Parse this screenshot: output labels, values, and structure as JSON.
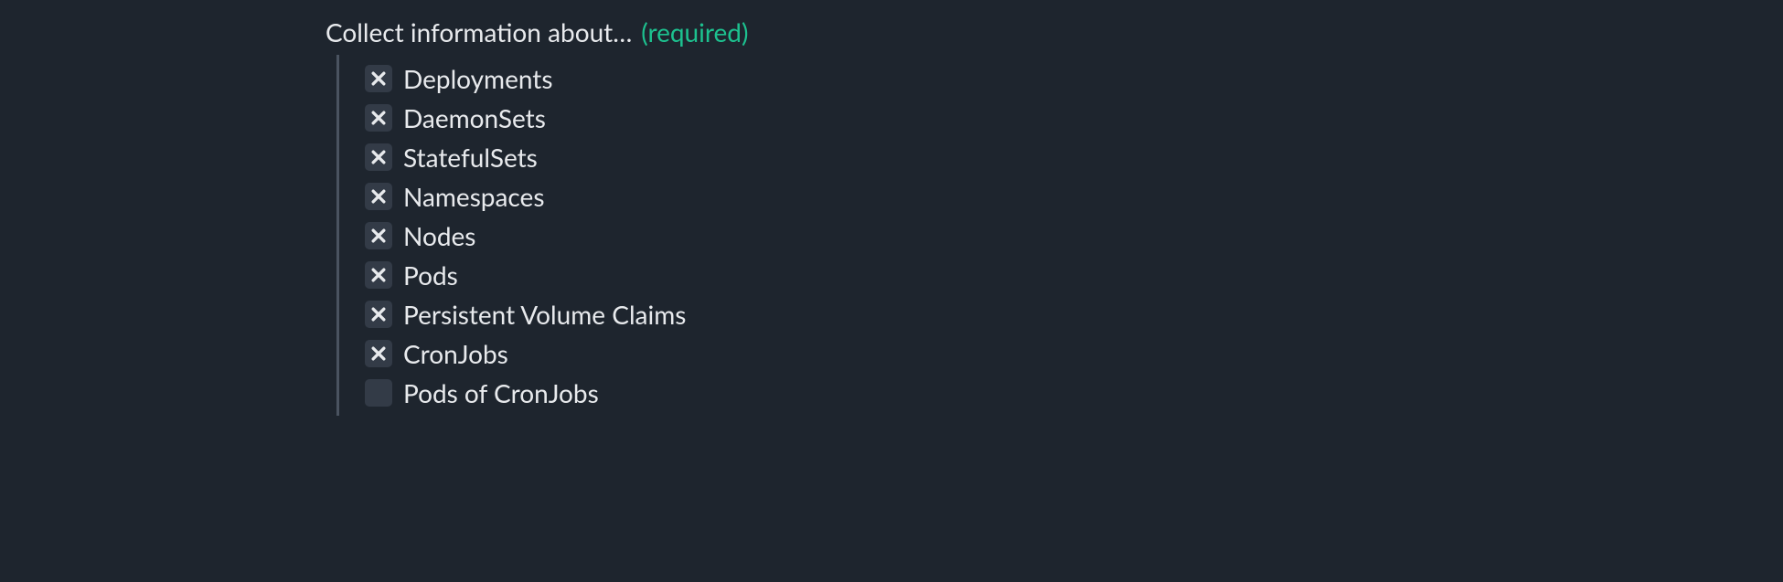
{
  "form": {
    "label": "Collect information about…",
    "required_hint": "(required)",
    "options": [
      {
        "label": "Deployments",
        "checked": true
      },
      {
        "label": "DaemonSets",
        "checked": true
      },
      {
        "label": "StatefulSets",
        "checked": true
      },
      {
        "label": "Namespaces",
        "checked": true
      },
      {
        "label": "Nodes",
        "checked": true
      },
      {
        "label": "Pods",
        "checked": true
      },
      {
        "label": "Persistent Volume Claims",
        "checked": true
      },
      {
        "label": "CronJobs",
        "checked": true
      },
      {
        "label": "Pods of CronJobs",
        "checked": false
      }
    ]
  }
}
